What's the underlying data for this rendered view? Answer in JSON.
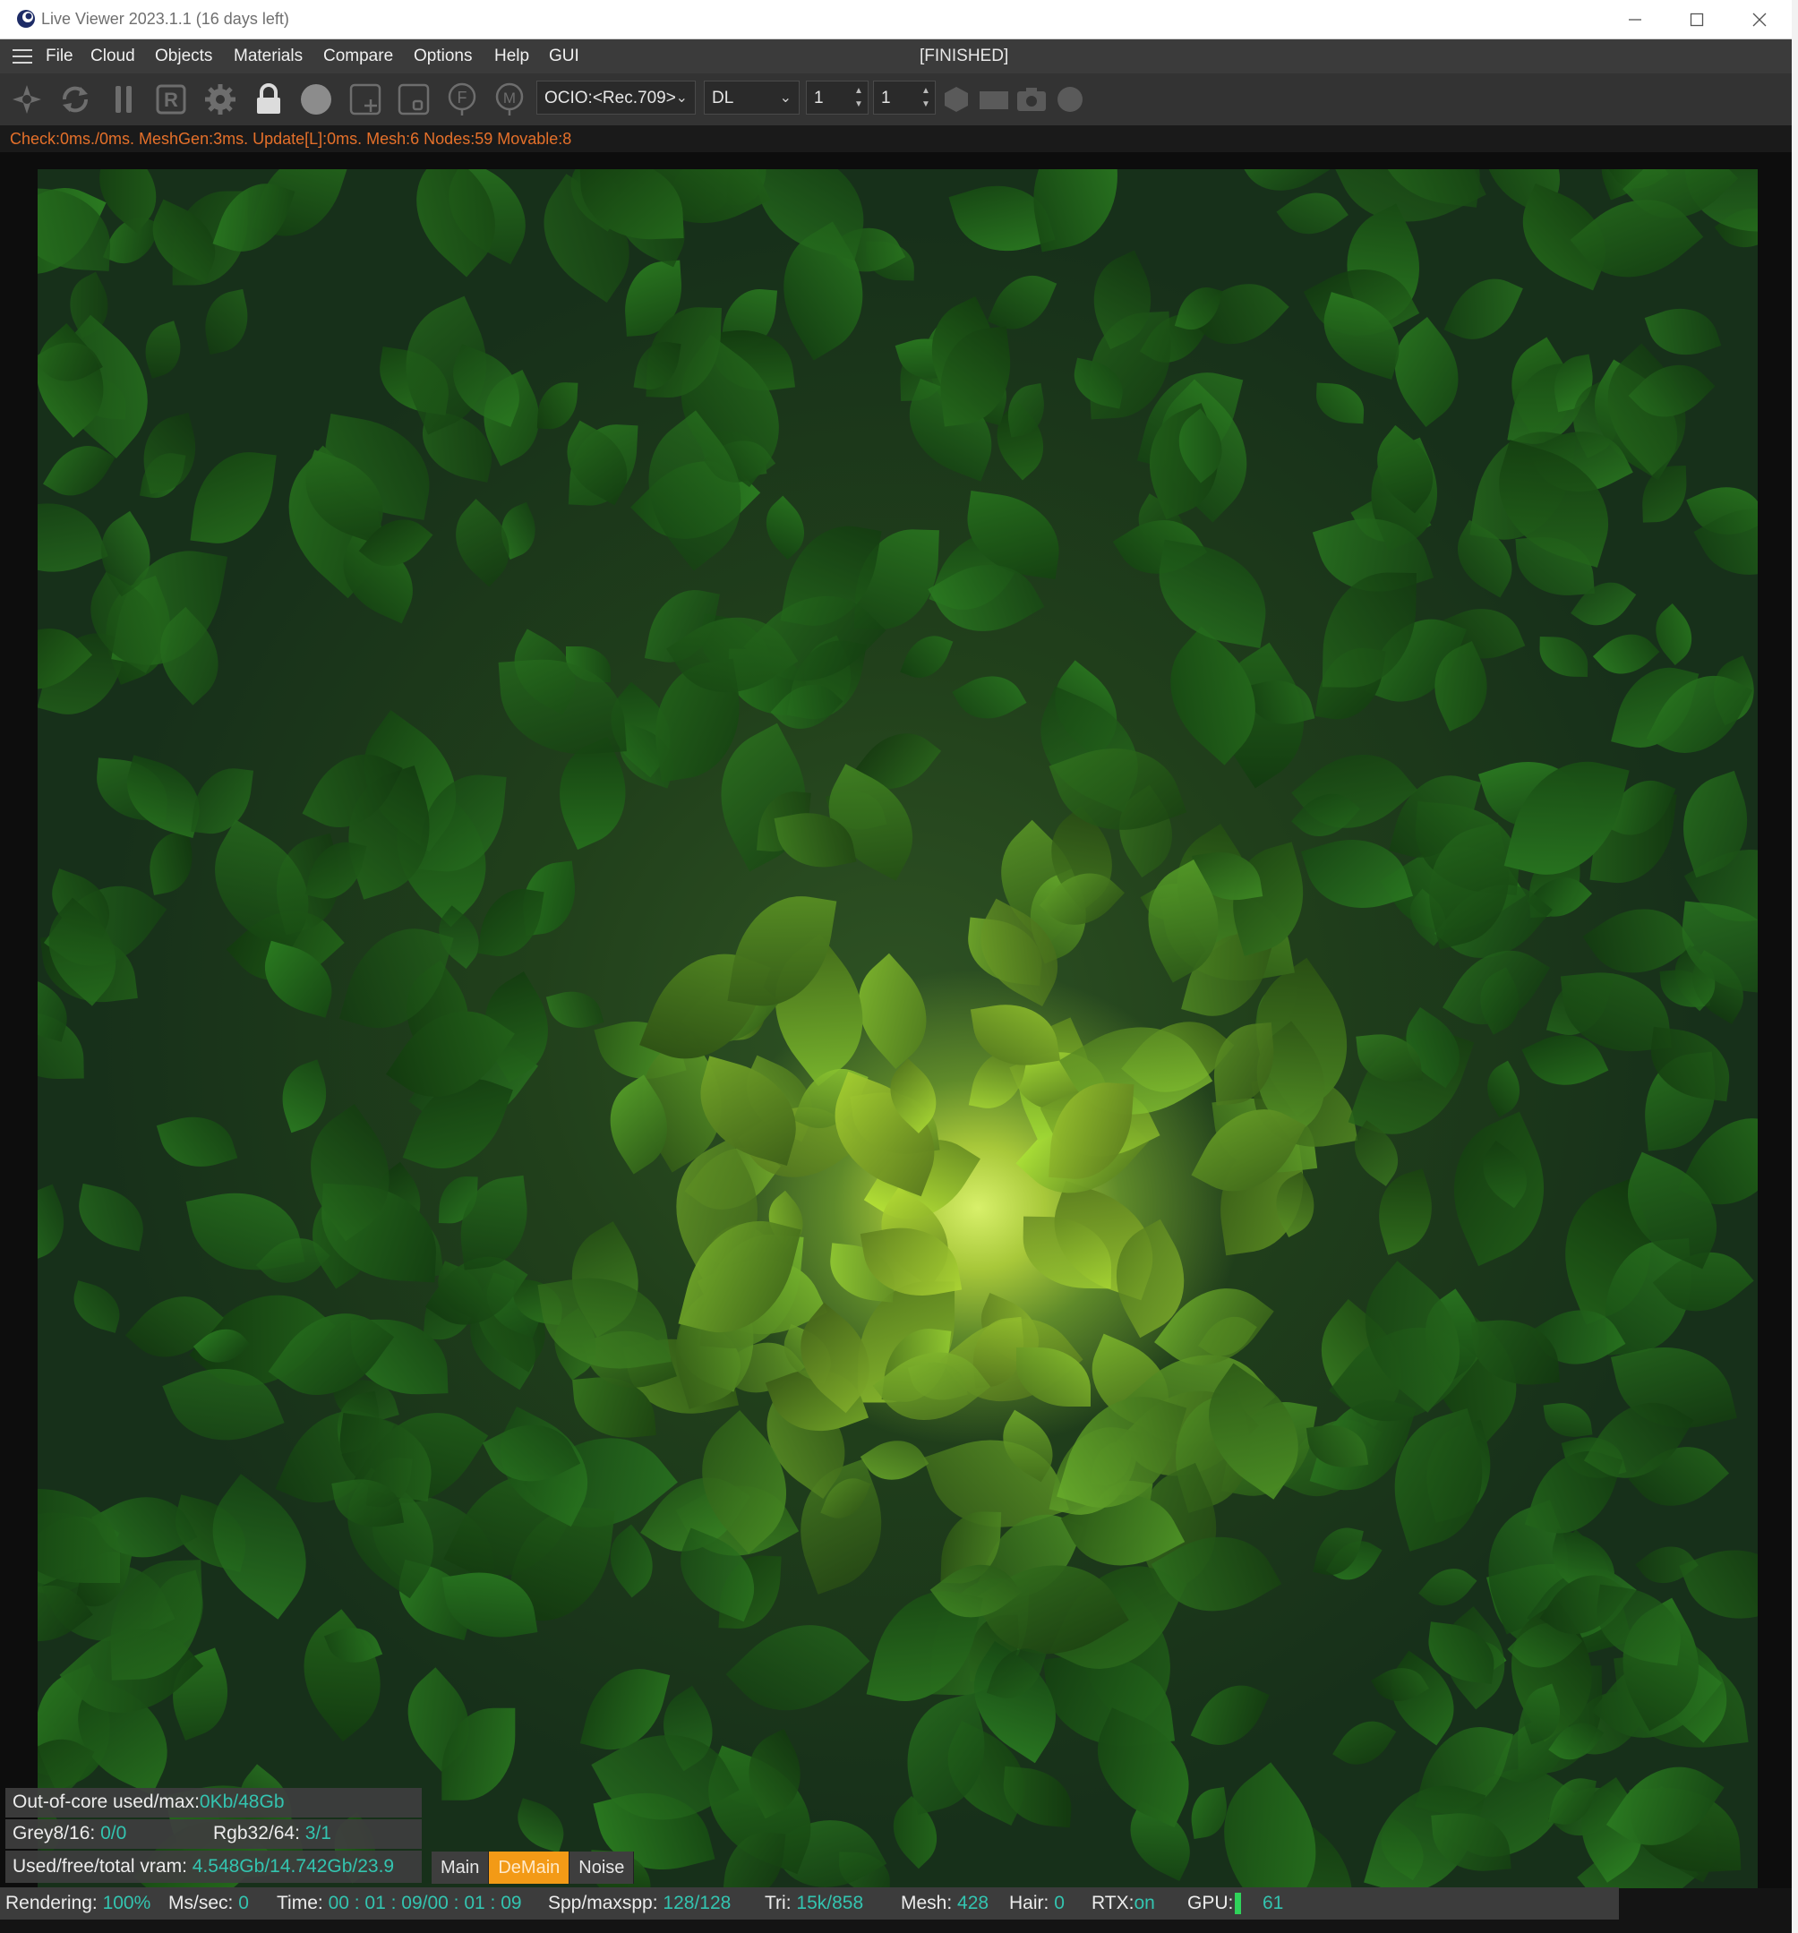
{
  "window": {
    "title": "Live Viewer 2023.1.1 (16 days left)",
    "controls": {
      "minimize": "–",
      "maximize": "☐",
      "close": "✕"
    }
  },
  "menubar": {
    "items": [
      "File",
      "Cloud",
      "Objects",
      "Materials",
      "Compare",
      "Options",
      "Help",
      "GUI"
    ],
    "status": "[FINISHED]"
  },
  "toolbar": {
    "icons": [
      "restart-icon",
      "refresh-icon",
      "pause-icon",
      "region-render-icon",
      "settings-gear-icon",
      "lock-icon",
      "clay-sphere-icon",
      "add-region-icon",
      "film-region-icon",
      "focus-picker-icon",
      "material-picker-icon",
      "hexagon-icon",
      "film-icon",
      "camera-icon",
      "dot-icon"
    ],
    "ocio_select": "OCIO:<Rec.709>",
    "kernel_select": "DL",
    "spin1": "1",
    "spin2": "1"
  },
  "info_line": "Check:0ms./0ms. MeshGen:3ms. Update[L]:0ms. Mesh:6 Nodes:59 Movable:8",
  "overlay": {
    "out_of_core_label": "Out-of-core used/max:",
    "out_of_core_value": "0Kb/48Gb",
    "grey_label": "Grey8/16: ",
    "grey_value": "0/0",
    "rgb_label": "Rgb32/64: ",
    "rgb_value": "3/1",
    "vram_label": "Used/free/total vram: ",
    "vram_value": "4.548Gb/14.742Gb/23.9",
    "tabs": [
      "Main",
      "DeMain",
      "Noise"
    ],
    "active_tab": "DeMain"
  },
  "statusbar": {
    "rendering_label": "Rendering: ",
    "rendering_value": "100%",
    "mssec_label": "Ms/sec: ",
    "mssec_value": "0",
    "time_label": "Time: ",
    "time_value": "00 : 01 : 09/00 : 01 : 09",
    "spp_label": "Spp/maxspp: ",
    "spp_value": "128/128",
    "tri_label": "Tri: ",
    "tri_value": "15k/858",
    "mesh_label": "Mesh: ",
    "mesh_value": "428",
    "hair_label": "Hair: ",
    "hair_value": "0",
    "rtx_label": "RTX:",
    "rtx_value": "on",
    "gpu_label": "GPU:",
    "gpu_value": "61"
  },
  "colors": {
    "accent_orange": "#f39a16",
    "value_teal": "#33c4b0",
    "info_orange": "#e5702a"
  }
}
